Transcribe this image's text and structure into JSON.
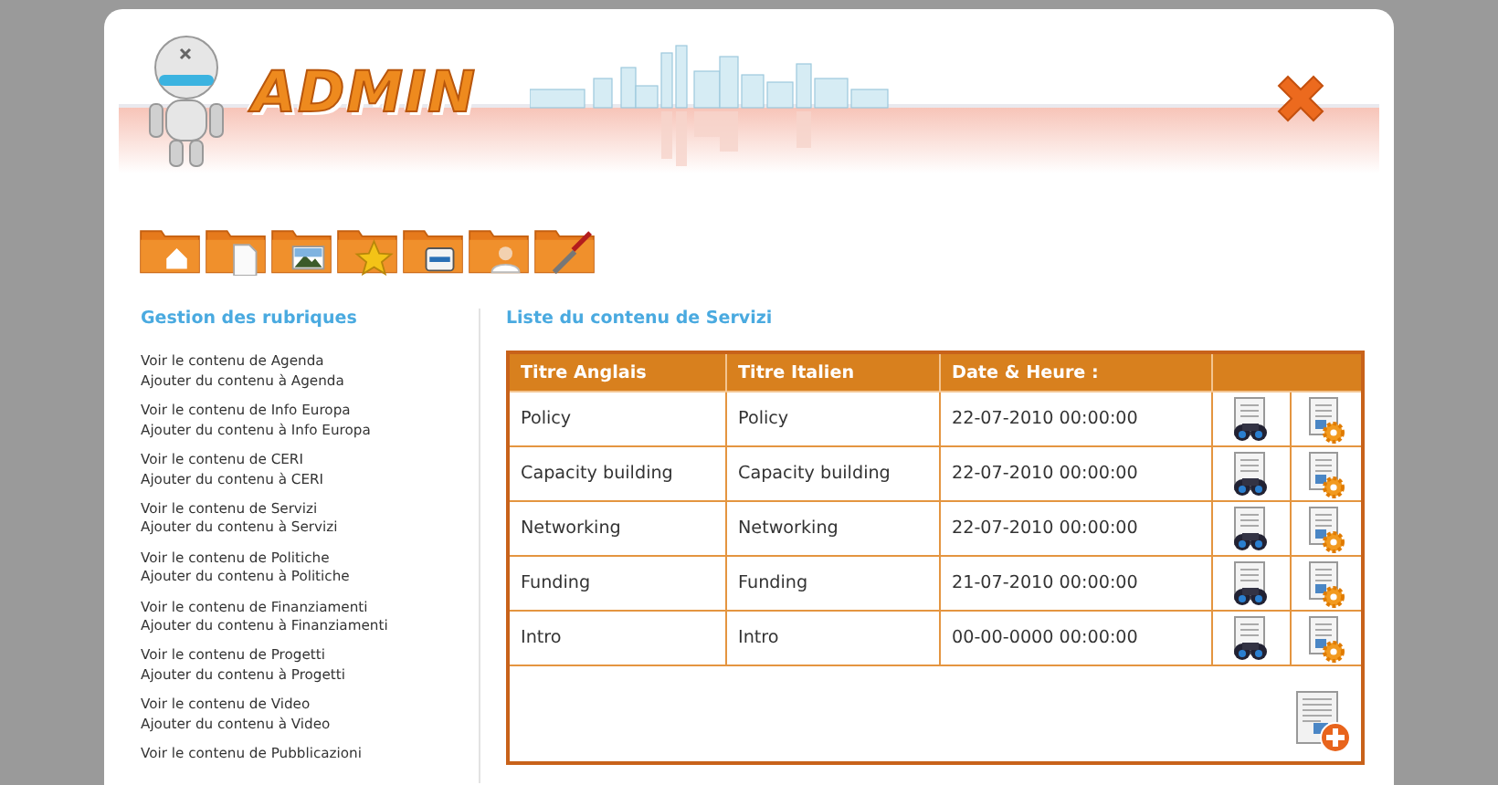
{
  "header": {
    "logo": "ADMIN"
  },
  "toolbar": [
    {
      "kind": "home"
    },
    {
      "kind": "document"
    },
    {
      "kind": "picture"
    },
    {
      "kind": "star"
    },
    {
      "kind": "drive"
    },
    {
      "kind": "user"
    },
    {
      "kind": "tools"
    }
  ],
  "sidebar": {
    "title": "Gestion des rubriques",
    "sections": [
      {
        "view": "Voir le contenu de Agenda",
        "add": "Ajouter du contenu à Agenda"
      },
      {
        "view": "Voir le contenu de Info Europa",
        "add": "Ajouter du contenu à Info Europa"
      },
      {
        "view": "Voir le contenu de CERI",
        "add": "Ajouter du contenu à CERI"
      },
      {
        "view": "Voir le contenu de Servizi",
        "add": "Ajouter du contenu à Servizi"
      },
      {
        "view": "Voir le contenu de Politiche",
        "add": "Ajouter du contenu à Politiche"
      },
      {
        "view": "Voir le contenu de Finanziamenti",
        "add": "Ajouter du contenu à Finanziamenti"
      },
      {
        "view": "Voir le contenu de Progetti",
        "add": "Ajouter du contenu à Progetti"
      },
      {
        "view": "Voir le contenu de Video",
        "add": "Ajouter du contenu à Video"
      },
      {
        "view": "Voir le contenu de Pubblicazioni"
      }
    ]
  },
  "content": {
    "title": "Liste du contenu de Servizi",
    "table": {
      "columns": [
        "Titre Anglais",
        "Titre Italien",
        "Date & Heure :"
      ],
      "rows": [
        {
          "english": "Policy",
          "italian": "Policy",
          "date": "22-07-2010 00:00:00"
        },
        {
          "english": "Capacity building",
          "italian": "Capacity building",
          "date": "22-07-2010 00:00:00"
        },
        {
          "english": "Networking",
          "italian": "Networking",
          "date": "22-07-2010 00:00:00"
        },
        {
          "english": "Funding",
          "italian": "Funding",
          "date": "21-07-2010 00:00:00"
        },
        {
          "english": "Intro",
          "italian": "Intro",
          "date": "00-00-0000 00:00:00"
        }
      ]
    }
  }
}
